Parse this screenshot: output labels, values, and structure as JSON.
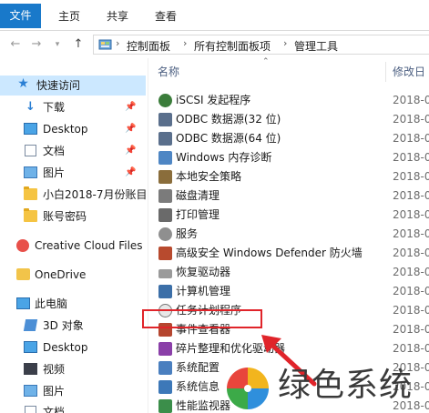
{
  "ribbon": {
    "tabs": [
      {
        "label": "文件",
        "active": true
      },
      {
        "label": "主页",
        "active": false
      },
      {
        "label": "共享",
        "active": false
      },
      {
        "label": "查看",
        "active": false
      }
    ]
  },
  "address": {
    "breadcrumbs": [
      "控制面板",
      "所有控制面板项",
      "管理工具"
    ]
  },
  "sidebar": {
    "items": [
      {
        "label": "快速访问",
        "icon": "star-icon"
      },
      {
        "label": "下载",
        "icon": "download-icon",
        "pinned": true
      },
      {
        "label": "Desktop",
        "icon": "desktop-icon",
        "pinned": true
      },
      {
        "label": "文档",
        "icon": "document-icon",
        "pinned": true
      },
      {
        "label": "图片",
        "icon": "picture-icon",
        "pinned": true
      },
      {
        "label": "小白2018-7月份账目",
        "icon": "folder-icon"
      },
      {
        "label": "账号密码",
        "icon": "folder-icon"
      },
      {
        "label": "Creative Cloud Files",
        "icon": "creative-cloud-icon"
      },
      {
        "label": "OneDrive",
        "icon": "onedrive-icon"
      },
      {
        "label": "此电脑",
        "icon": "computer-icon"
      },
      {
        "label": "3D 对象",
        "icon": "3d-objects-icon"
      },
      {
        "label": "Desktop",
        "icon": "desktop-icon"
      },
      {
        "label": "视频",
        "icon": "video-icon"
      },
      {
        "label": "图片",
        "icon": "picture-icon"
      },
      {
        "label": "文档",
        "icon": "document-icon"
      }
    ]
  },
  "list": {
    "columns": {
      "name": "名称",
      "modified": "修改日"
    },
    "rows": [
      {
        "name": "iSCSI 发起程序",
        "date": "2018-0",
        "icon": "iscsi-icon"
      },
      {
        "name": "ODBC 数据源(32 位)",
        "date": "2018-0",
        "icon": "odbc-icon"
      },
      {
        "name": "ODBC 数据源(64 位)",
        "date": "2018-0",
        "icon": "odbc-icon"
      },
      {
        "name": "Windows 内存诊断",
        "date": "2018-0",
        "icon": "memory-diagnostic-icon"
      },
      {
        "name": "本地安全策略",
        "date": "2018-0",
        "icon": "security-policy-icon"
      },
      {
        "name": "磁盘清理",
        "date": "2018-0",
        "icon": "disk-cleanup-icon"
      },
      {
        "name": "打印管理",
        "date": "2018-0",
        "icon": "print-management-icon"
      },
      {
        "name": "服务",
        "date": "2018-0",
        "icon": "services-icon"
      },
      {
        "name": "高级安全 Windows Defender 防火墙",
        "date": "2018-0",
        "icon": "firewall-icon"
      },
      {
        "name": "恢复驱动器",
        "date": "2018-0",
        "icon": "recovery-drive-icon"
      },
      {
        "name": "计算机管理",
        "date": "2018-0",
        "icon": "computer-management-icon",
        "highlighted": true
      },
      {
        "name": "任务计划程序",
        "date": "2018-0",
        "icon": "task-scheduler-icon"
      },
      {
        "name": "事件查看器",
        "date": "2018-0",
        "icon": "event-viewer-icon"
      },
      {
        "name": "碎片整理和优化驱动器",
        "date": "2018-0",
        "icon": "defrag-icon"
      },
      {
        "name": "系统配置",
        "date": "2018-0",
        "icon": "system-config-icon"
      },
      {
        "name": "系统信息",
        "date": "2018-0",
        "icon": "system-info-icon"
      },
      {
        "name": "性能监视器",
        "date": "2018-0",
        "icon": "performance-monitor-icon"
      }
    ]
  },
  "watermark": {
    "text": "绿色系统"
  },
  "colors": {
    "accent": "#1979ca",
    "highlight": "#e0242a",
    "selected": "#cce8ff"
  }
}
